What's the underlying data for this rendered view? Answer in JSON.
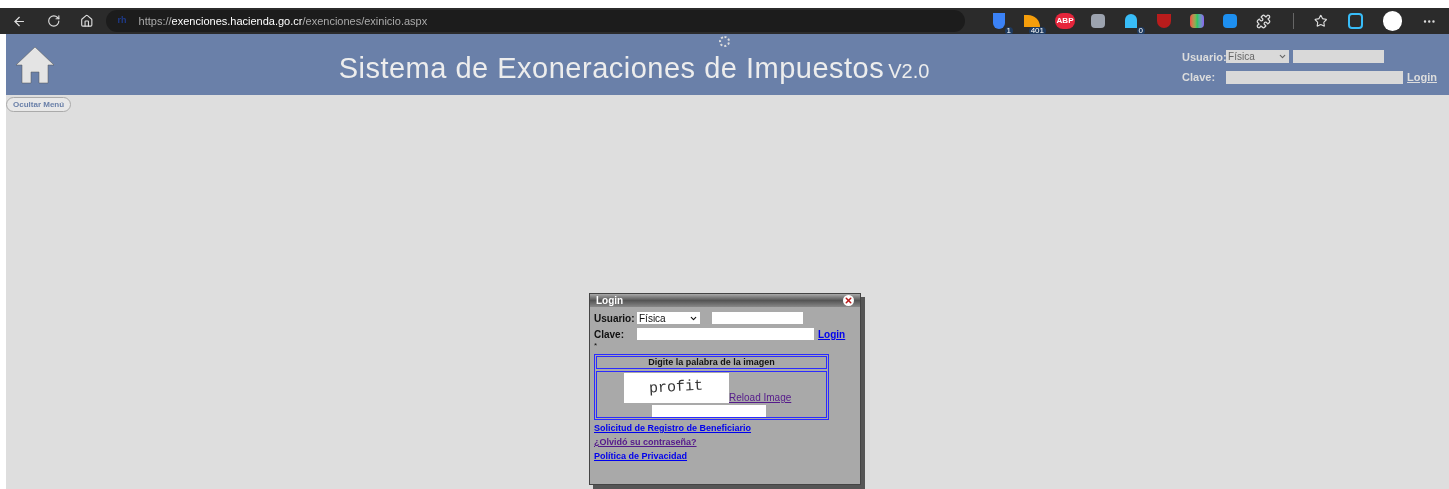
{
  "browser": {
    "url_scheme": "https://",
    "url_host": "exenciones.hacienda.go.cr",
    "url_path": "/exenciones/exinicio.aspx",
    "site_badge": "rh",
    "extensions": [
      {
        "kind": "shield",
        "badge": "1"
      },
      {
        "kind": "feed",
        "badge": "401"
      },
      {
        "kind": "abp",
        "badge": "ABP"
      },
      {
        "kind": "grey"
      },
      {
        "kind": "ghost",
        "badge": "0"
      },
      {
        "kind": "ublock"
      },
      {
        "kind": "rainbow"
      },
      {
        "kind": "s"
      },
      {
        "kind": "puzzle"
      }
    ]
  },
  "header": {
    "title": "Sistema de Exoneraciones de Impuestos",
    "version": "V2.0",
    "login": {
      "user_label": "Usuario:",
      "user_type": "Física",
      "password_label": "Clave:",
      "login_link": "Login"
    }
  },
  "hide_menu_button": "Ocultar Menú",
  "dialog": {
    "title": "Login",
    "user_label": "Usuario:",
    "user_type": "Física",
    "password_label": "Clave:",
    "login_link": "Login",
    "required_mark": "*",
    "captcha_heading": "Digite la palabra de la imagen",
    "captcha_word": "profit",
    "reload_link": "Reload Image",
    "links": [
      {
        "text": "Solicitud de Registro de Beneficiario",
        "visited": false
      },
      {
        "text": "¿Olvidó su contraseña?",
        "visited": true
      },
      {
        "text": "Política de Privacidad",
        "visited": false
      }
    ]
  }
}
